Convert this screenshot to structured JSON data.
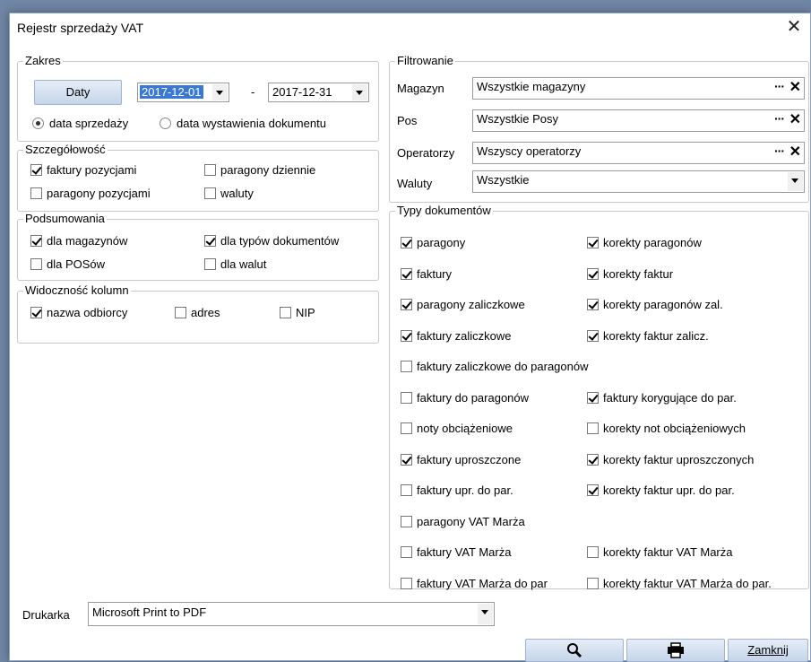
{
  "window": {
    "title": "Rejestr sprzedaży VAT"
  },
  "zakres": {
    "title": "Zakres",
    "button": "Daty",
    "date_from": "2017-12-01",
    "separator": "-",
    "date_to": "2017-12-31",
    "radio1": "data sprzedaży",
    "radio2": "data wystawienia dokumentu"
  },
  "szczegolowosc": {
    "title": "Szczegółowość",
    "items": [
      "faktury pozycjami",
      "paragony dziennie",
      "paragony pozycjami",
      "waluty"
    ]
  },
  "podsumowania": {
    "title": "Podsumowania",
    "items": [
      "dla magazynów",
      "dla typów dokumentów",
      "dla POSów",
      "dla walut"
    ]
  },
  "widocznosc": {
    "title": "Widoczność kolumn",
    "items": [
      "nazwa odbiorcy",
      "adres",
      "NIP"
    ]
  },
  "filtrowanie": {
    "title": "Filtrowanie",
    "rows": [
      {
        "label": "Magazyn",
        "value": "Wszystkie magazyny"
      },
      {
        "label": "Pos",
        "value": "Wszystkie Posy"
      },
      {
        "label": "Operatorzy",
        "value": "Wszyscy operatorzy"
      },
      {
        "label": "Waluty",
        "value": "Wszystkie"
      }
    ]
  },
  "typy": {
    "title": "Typy dokumentów",
    "items": [
      "paragony",
      "korekty paragonów",
      "faktury",
      "korekty faktur",
      "paragony zaliczkowe",
      "korekty paragonów zal.",
      "faktury zaliczkowe",
      "korekty faktur zalicz.",
      "faktury zaliczkowe do paragonów",
      "faktury do paragonów",
      "faktury korygujące do par.",
      "noty obciążeniowe",
      "korekty not obciążeniowych",
      "faktury uproszczone",
      "korekty faktur uproszczonych",
      "faktury upr. do par.",
      "korekty faktur upr. do par.",
      "paragony VAT Marża",
      "faktury VAT Marża",
      "korekty faktur VAT Marża",
      "faktury VAT Marża do par",
      "korekty faktur VAT Marża do par."
    ]
  },
  "drukarka": {
    "label": "Drukarka",
    "value": "Microsoft Print to PDF"
  },
  "footer": {
    "close_label": "Zamknij"
  }
}
